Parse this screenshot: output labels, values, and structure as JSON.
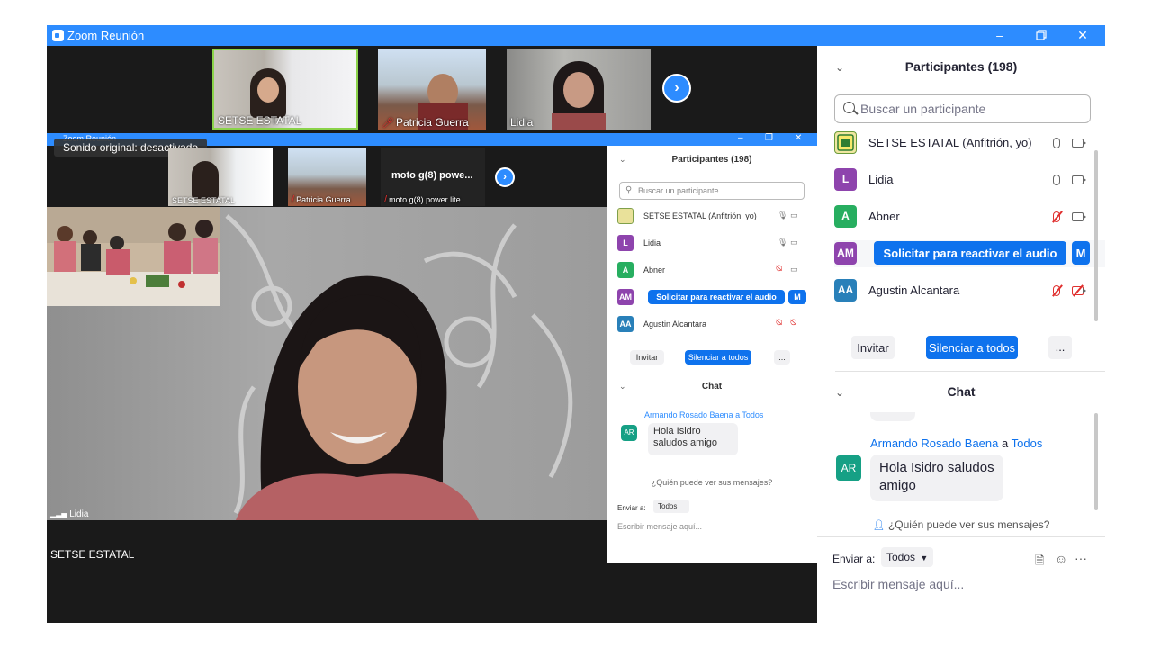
{
  "window": {
    "title": "Zoom Reunión"
  },
  "thumbnails": [
    {
      "name": "SETSE ESTATAL",
      "muted": false
    },
    {
      "name": "Patricia Guerra",
      "muted": true
    },
    {
      "name": "Lidia",
      "muted": false
    }
  ],
  "inner": {
    "title": "Zoom Reunión",
    "sonido": "Sonido original: desactivado",
    "thumbnails": [
      {
        "name": "SETSE ESTATAL",
        "muted": false
      },
      {
        "name": "Patricia Guerra",
        "muted": true
      },
      {
        "name": "moto g(8) power lite",
        "title": "moto g(8) powe...",
        "muted": true
      }
    ],
    "speaker_name": "Lidia",
    "bottom_name": "SETSE ESTATAL",
    "panel": {
      "participants_header": "Participantes (198)",
      "search_placeholder": "Buscar un participante",
      "participants": [
        {
          "initials": "",
          "name": "SETSE ESTATAL (Anfitrión, yo)",
          "color": "#e9d64a"
        },
        {
          "initials": "L",
          "name": "Lidia",
          "color": "#8e44ad"
        },
        {
          "initials": "A",
          "name": "Abner",
          "color": "#27ae60"
        },
        {
          "initials": "AM",
          "name": "",
          "color": "#8e44ad"
        },
        {
          "initials": "AA",
          "name": "Agustin Alcantara",
          "color": "#2980b9"
        }
      ],
      "request_unmute": "Solicitar para reactivar el audio",
      "request_more": "M",
      "invite": "Invitar",
      "mute_all": "Silenciar a todos",
      "more": "...",
      "chat_header": "Chat",
      "chat_sender": "Armando Rosado Baena a Todos",
      "chat_initials": "AR",
      "chat_message": "Hola Isidro saludos amigo",
      "who_can_see": "¿Quién puede ver sus mensajes?",
      "send_to_label": "Enviar a:",
      "send_to_value": "Todos",
      "message_placeholder": "Escribir mensaje aquí..."
    }
  },
  "panel": {
    "participants_header": "Participantes (198)",
    "search_placeholder": "Buscar un participante",
    "participants": [
      {
        "initials": "",
        "name": "SETSE ESTATAL (Anfitrión, yo)",
        "color": "#e9d64a",
        "mic_muted": false,
        "video_off": false
      },
      {
        "initials": "L",
        "name": "Lidia",
        "color": "#8e44ad",
        "mic_muted": false,
        "video_off": false
      },
      {
        "initials": "A",
        "name": "Abner",
        "color": "#27ae60",
        "mic_muted": true,
        "video_off": false
      },
      {
        "initials": "AM",
        "name": "",
        "color": "#8e44ad",
        "mic_muted": false,
        "video_off": false
      },
      {
        "initials": "AA",
        "name": "Agustin Alcantara",
        "color": "#2980b9",
        "mic_muted": true,
        "video_off": true
      }
    ],
    "request_unmute": "Solicitar para reactivar el audio",
    "request_more": "M",
    "invite": "Invitar",
    "mute_all": "Silenciar a todos",
    "more": "...",
    "chat_header": "Chat",
    "chat_sender_name": "Armando Rosado Baena",
    "chat_sender_to": "a",
    "chat_sender_target": "Todos",
    "chat_initials": "AR",
    "chat_message": "Hola Isidro saludos amigo",
    "who_can_see": "¿Quién puede ver sus mensajes?",
    "send_to_label": "Enviar a:",
    "send_to_value": "Todos",
    "message_placeholder": "Escribir mensaje aquí...",
    "more_options": "···"
  },
  "colors": {
    "accent": "#2d8cff",
    "muted": "#e0302f",
    "chat_link": "#0e72ed"
  }
}
